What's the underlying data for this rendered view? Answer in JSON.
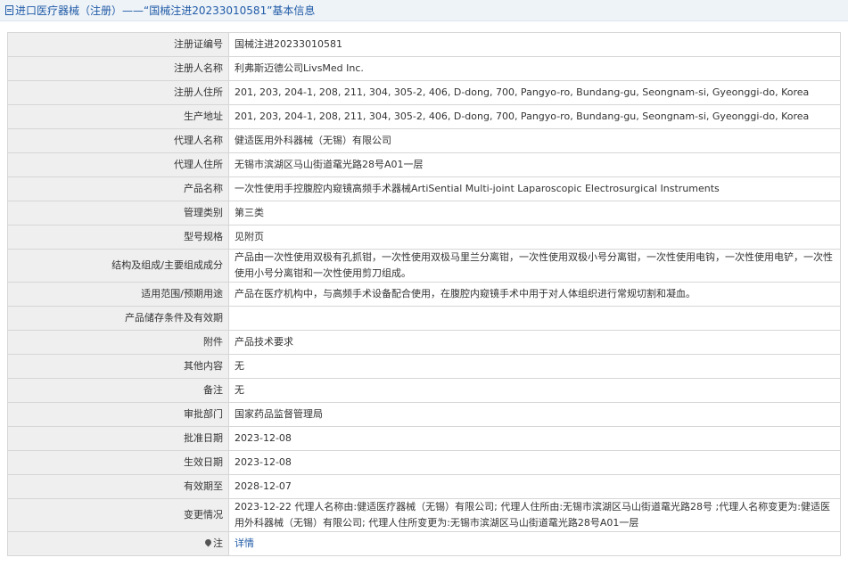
{
  "header": {
    "title": "进口医疗器械（注册）——“国械注进20233010581”基本信息"
  },
  "rows": [
    {
      "label": "注册证编号",
      "value": "国械注进20233010581"
    },
    {
      "label": "注册人名称",
      "value": "利弗斯迈德公司LivsMed Inc."
    },
    {
      "label": "注册人住所",
      "value": "201, 203, 204-1, 208, 211, 304, 305-2, 406, D-dong, 700, Pangyo-ro, Bundang-gu, Seongnam-si, Gyeonggi-do, Korea"
    },
    {
      "label": "生产地址",
      "value": "201, 203, 204-1, 208, 211, 304, 305-2, 406, D-dong, 700, Pangyo-ro, Bundang-gu, Seongnam-si, Gyeonggi-do, Korea"
    },
    {
      "label": "代理人名称",
      "value": "健适医用外科器械（无锡）有限公司"
    },
    {
      "label": "代理人住所",
      "value": "无锡市滨湖区马山街道鼋光路28号A01一层"
    },
    {
      "label": "产品名称",
      "value": "一次性使用手控腹腔内窥镜高频手术器械ArtiSential Multi-joint Laparoscopic Electrosurgical Instruments"
    },
    {
      "label": "管理类别",
      "value": "第三类"
    },
    {
      "label": "型号规格",
      "value": "见附页"
    },
    {
      "label": "结构及组成/主要组成成分",
      "value": "产品由一次性使用双极有孔抓钳，一次性使用双极马里兰分离钳，一次性使用双极小号分离钳，一次性使用电钩，一次性使用电铲，一次性使用小号分离钳和一次性使用剪刀组成。"
    },
    {
      "label": "适用范围/预期用途",
      "value": "产品在医疗机构中，与高频手术设备配合使用，在腹腔内窥镜手术中用于对人体组织进行常规切割和凝血。"
    },
    {
      "label": "产品储存条件及有效期",
      "value": ""
    },
    {
      "label": "附件",
      "value": "产品技术要求"
    },
    {
      "label": "其他内容",
      "value": "无"
    },
    {
      "label": "备注",
      "value": "无"
    },
    {
      "label": "审批部门",
      "value": "国家药品监督管理局"
    },
    {
      "label": "批准日期",
      "value": "2023-12-08"
    },
    {
      "label": "生效日期",
      "value": "2023-12-08"
    },
    {
      "label": "有效期至",
      "value": "2028-12-07"
    },
    {
      "label": "变更情况",
      "value": "2023-12-22 代理人名称由:健适医疗器械（无锡）有限公司; 代理人住所由:无锡市滨湖区马山街道鼋光路28号 ;代理人名称变更为:健适医用外科器械（无锡）有限公司; 代理人住所变更为:无锡市滨湖区马山街道鼋光路28号A01一层"
    }
  ],
  "note_row": {
    "label": "注",
    "link": "详情"
  }
}
